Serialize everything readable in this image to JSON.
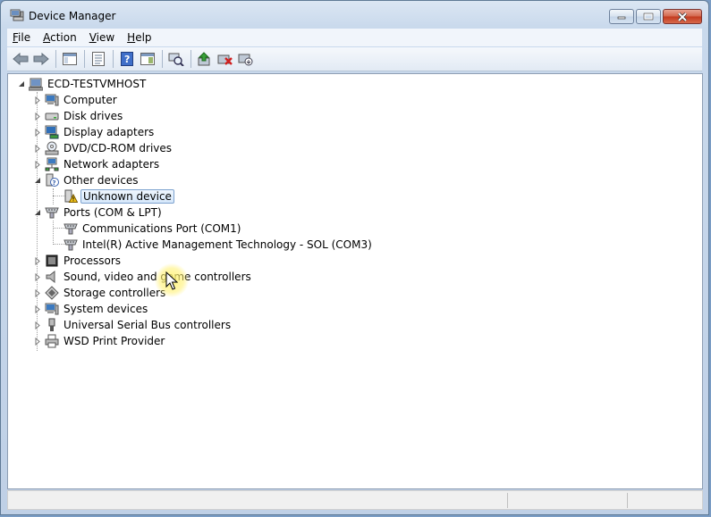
{
  "window": {
    "title": "Device Manager",
    "icon": "device-manager-icon"
  },
  "menu": [
    {
      "label": "File",
      "mnemonic": "F",
      "rest": "ile"
    },
    {
      "label": "Action",
      "mnemonic": "A",
      "rest": "ction"
    },
    {
      "label": "View",
      "mnemonic": "V",
      "rest": "iew"
    },
    {
      "label": "Help",
      "mnemonic": "H",
      "rest": "elp"
    }
  ],
  "toolbar": [
    "back-arrow-icon",
    "forward-arrow-icon",
    "show-hide-console-tree-icon",
    "properties-icon",
    "help-icon",
    "action-pane-icon",
    "scan-hardware-icon",
    "update-driver-icon",
    "uninstall-device-icon",
    "disable-device-icon"
  ],
  "tree": {
    "root": "ECD-TESTVMHOST",
    "categories": [
      {
        "label": "Computer",
        "icon": "computer-icon",
        "expanded": false
      },
      {
        "label": "Disk drives",
        "icon": "disk-drive-icon",
        "expanded": false
      },
      {
        "label": "Display adapters",
        "icon": "display-adapter-icon",
        "expanded": false
      },
      {
        "label": "DVD/CD-ROM drives",
        "icon": "dvd-drive-icon",
        "expanded": false
      },
      {
        "label": "Network adapters",
        "icon": "network-adapter-icon",
        "expanded": false
      },
      {
        "label": "Other devices",
        "icon": "other-devices-icon",
        "expanded": true,
        "children": [
          {
            "label": "Unknown device",
            "icon": "unknown-device-warning-icon",
            "selected": true
          }
        ]
      },
      {
        "label": "Ports (COM & LPT)",
        "icon": "port-icon",
        "expanded": true,
        "children": [
          {
            "label": "Communications Port (COM1)",
            "icon": "port-icon"
          },
          {
            "label": "Intel(R) Active Management Technology - SOL (COM3)",
            "icon": "port-icon"
          }
        ]
      },
      {
        "label": "Processors",
        "icon": "processor-icon",
        "expanded": false
      },
      {
        "label": "Sound, video and game controllers",
        "icon": "sound-icon",
        "expanded": false
      },
      {
        "label": "Storage controllers",
        "icon": "storage-controller-icon",
        "expanded": false
      },
      {
        "label": "System devices",
        "icon": "system-devices-icon",
        "expanded": false
      },
      {
        "label": "Universal Serial Bus controllers",
        "icon": "usb-icon",
        "expanded": false
      },
      {
        "label": "WSD Print Provider",
        "icon": "printer-icon",
        "expanded": false
      }
    ]
  }
}
